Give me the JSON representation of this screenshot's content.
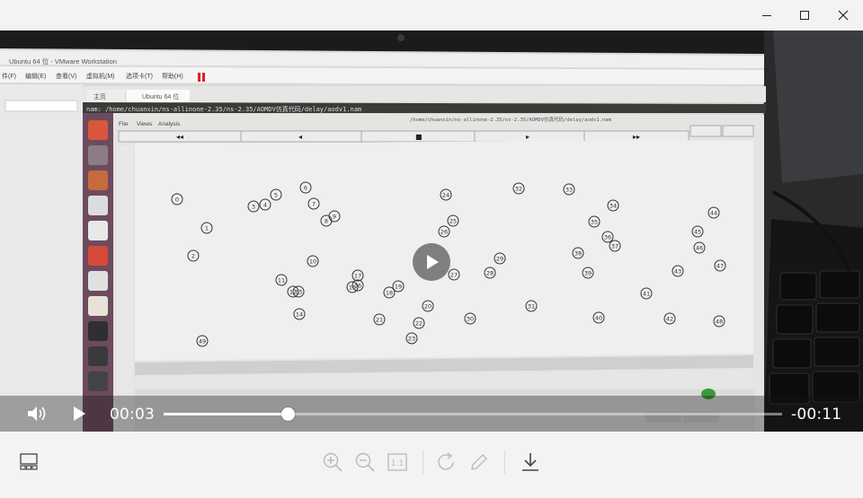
{
  "window": {
    "minimize_icon": "minimize-icon",
    "maximize_icon": "maximize-icon",
    "close_icon": "close-icon"
  },
  "video": {
    "description_icon": "video-frame",
    "vm_title": "Ubuntu 64 位 - VMware Workstation",
    "vm_menu": [
      "件(F)",
      "编辑(E)",
      "查看(V)",
      "虚拟机(M)",
      "选项卡(T)",
      "帮助(H)"
    ],
    "tabs": [
      "主页",
      "Ubuntu 64 位"
    ],
    "nam_title": "nam: /home/chuanxin/ns-allinone-2.35/ns-2.35/AOMDV仿真代码/delay/aodv1.nam",
    "nam_menu": [
      "File",
      "Views",
      "Analysis"
    ],
    "nam_path": "/home/chuanxin/ns-allinone-2.35/ns-2.35/AOMDV仿真代码/delay/aodv1.nam",
    "nodes": [
      "0",
      "1",
      "2",
      "3",
      "4",
      "5",
      "6",
      "7",
      "8",
      "9",
      "10",
      "11",
      "12",
      "13",
      "14",
      "15",
      "16",
      "17",
      "18",
      "19",
      "20",
      "21",
      "22",
      "23",
      "24",
      "25",
      "26",
      "27",
      "28",
      "29",
      "30",
      "31",
      "32",
      "33",
      "34",
      "35",
      "36",
      "37",
      "38",
      "39",
      "40",
      "41",
      "42",
      "43",
      "44",
      "45",
      "46",
      "47",
      "48",
      "49"
    ]
  },
  "player": {
    "volume_icon": "volume-icon",
    "play_icon": "play-icon",
    "elapsed": "00:03",
    "remaining": "-00:11",
    "progress": 0.2
  },
  "toolbar": {
    "icons": [
      "gallery-icon",
      "zoom-in-icon",
      "zoom-out-icon",
      "actual-size-icon",
      "rotate-icon",
      "edit-icon",
      "download-icon"
    ],
    "actual_size_label": "1:1"
  }
}
